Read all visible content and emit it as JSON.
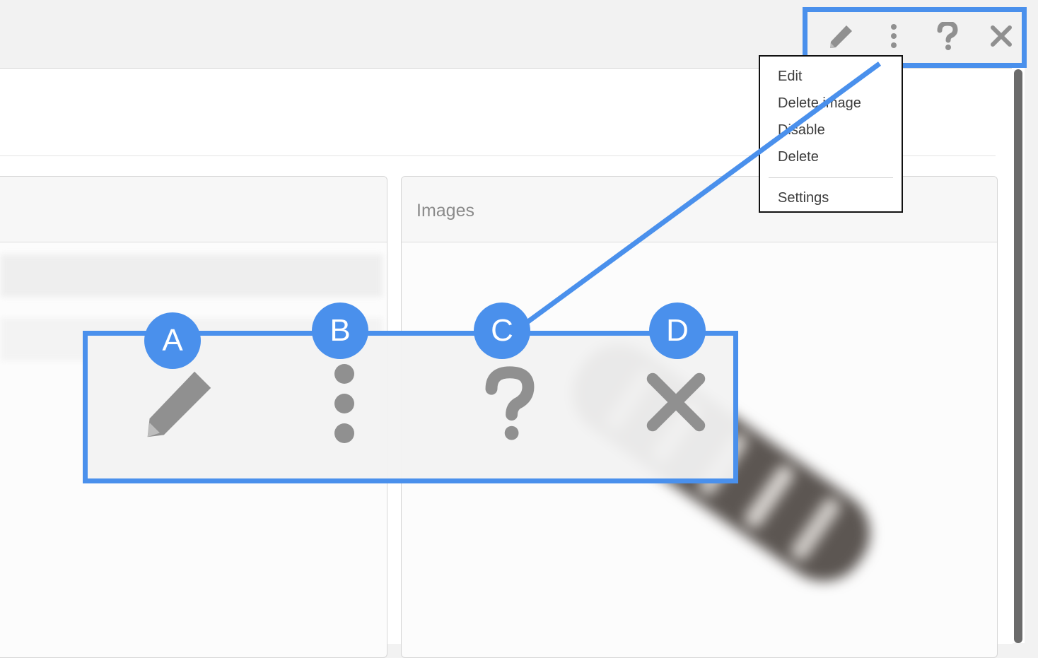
{
  "toolbar": {
    "icons": [
      "pencil-icon",
      "kebab-menu-icon",
      "help-icon",
      "close-icon"
    ]
  },
  "menu": {
    "items": [
      "Edit",
      "Delete image",
      "Disable",
      "Delete"
    ],
    "settings_label": "Settings"
  },
  "panels": {
    "images_title": "Images"
  },
  "callout": {
    "labels": [
      "A",
      "B",
      "C",
      "D"
    ],
    "accent_color": "#4a90ec",
    "icon_color": "#909090"
  }
}
